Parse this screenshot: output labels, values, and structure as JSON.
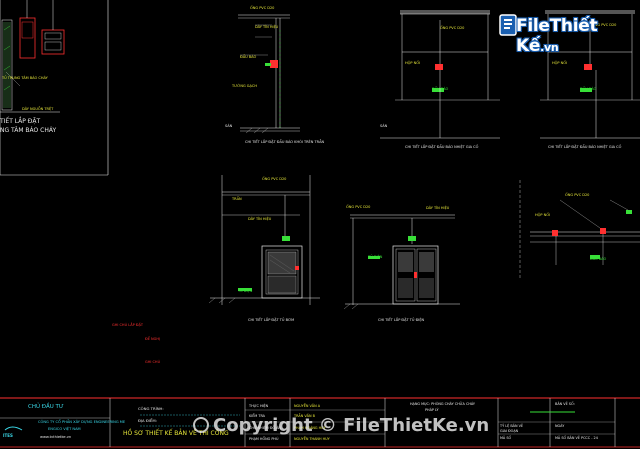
{
  "logo": {
    "brand": "FileThiết Kế",
    "suffix": ".vn",
    "icon": "document-folder-icon"
  },
  "watermark": {
    "text": "Copyright © FileThietKe.vn",
    "icon": "copyright-icon"
  },
  "left_panel": {
    "label_title_1": "TIẾT LẮP ĐẶT",
    "label_title_2": "NG TÂM BÁO CHÁY",
    "label_note_1": "TỦ TRUNG TÂM BÁO CHÁY",
    "label_note_2": "DÂY NGUỒN TRỆT"
  },
  "details": {
    "d1_caption": "CHI TIẾT LẮP ĐẶT ĐẦU BÁO KHÓI TRÊN TRẦN",
    "d2_caption": "CHI TIẾT LẮP ĐẶT ĐẦU BÁO NHIỆT GIA CỐ",
    "d3_caption": "CHI TIẾT LẮP ĐẶT ĐẦU BÁO NHIỆT GIA CỐ",
    "d4_caption": "CHI TIẾT LẮP ĐẶT TỦ BƠM",
    "d5_caption": "CHI TIẾT LẮP ĐẶT TỦ ĐIỆN",
    "tag_ong": "ỐNG PVC D20",
    "tag_day": "DÂY TÍN HIỆU",
    "tag_tran": "TRẦN",
    "tag_san": "SÀN",
    "tag_tuong": "TƯỜNG GẠCH",
    "tag_dau": "ĐẦU BÁO",
    "tag_hop": "HỘP NỐI",
    "tag_tu": "TỦ ĐIỆN"
  },
  "notes_red": {
    "line1": "GHI CHÚ LẮP ĐẶT",
    "line2": "ĐỀ NGHỊ",
    "line3": "GHI CHÚ"
  },
  "title_block": {
    "owner_label": "CHỦ ĐẦU TƯ",
    "company_1": "CÔNG TY CỔ PHẦN XÂY DỰNG ENGINEERING ME",
    "company_2": "ENGICO VIỆT NAM",
    "company_url": "www.tvthietke.vn",
    "company_mark": "ITES",
    "project_label": "CÔNG TRÌNH:",
    "location_label": "ĐỊA ĐIỂM:",
    "doc_title": "HỒ SƠ THIẾT KẾ BẢN VẼ THI CÔNG",
    "role_1": "THỰC HIỆN",
    "role_2": "KIỂM TRA",
    "role_3": "CHỦ NHIỆM ĐỒ ÁN",
    "role_4": "PHẠM HỒNG PHÚ",
    "name_1": "NGUYỄN VĂN A",
    "name_2": "TRẦN VĂN B",
    "name_3": "PHẠM HOÀNG HUY",
    "name_4": "NGUYỄN THANH HUY",
    "appr_1": "HẠNG MỤC: PHÒNG CHÁY CHỮA CHÁY",
    "appr_2": "PHÁP LÝ",
    "date_label": "BẢN VẼ SỐ:",
    "sheet_1": "TỶ LỆ BẢN VẼ",
    "sheet_2": "GIAI ĐOẠN",
    "sheet_3": "MÃ SỐ",
    "sheet_4": "NGÀY",
    "sheet_val": "MÃ SỐ BẢN VẼ PCCC - 24"
  },
  "colors": {
    "background": "#000000",
    "line_white": "#e8e8e8",
    "line_yellow": "#e8e83a",
    "line_green": "#38e038",
    "line_red": "#ff3030",
    "line_cyan": "#3ad8e8",
    "title_block_border": "#ff3030",
    "brand_blue": "#1a5fb0"
  }
}
